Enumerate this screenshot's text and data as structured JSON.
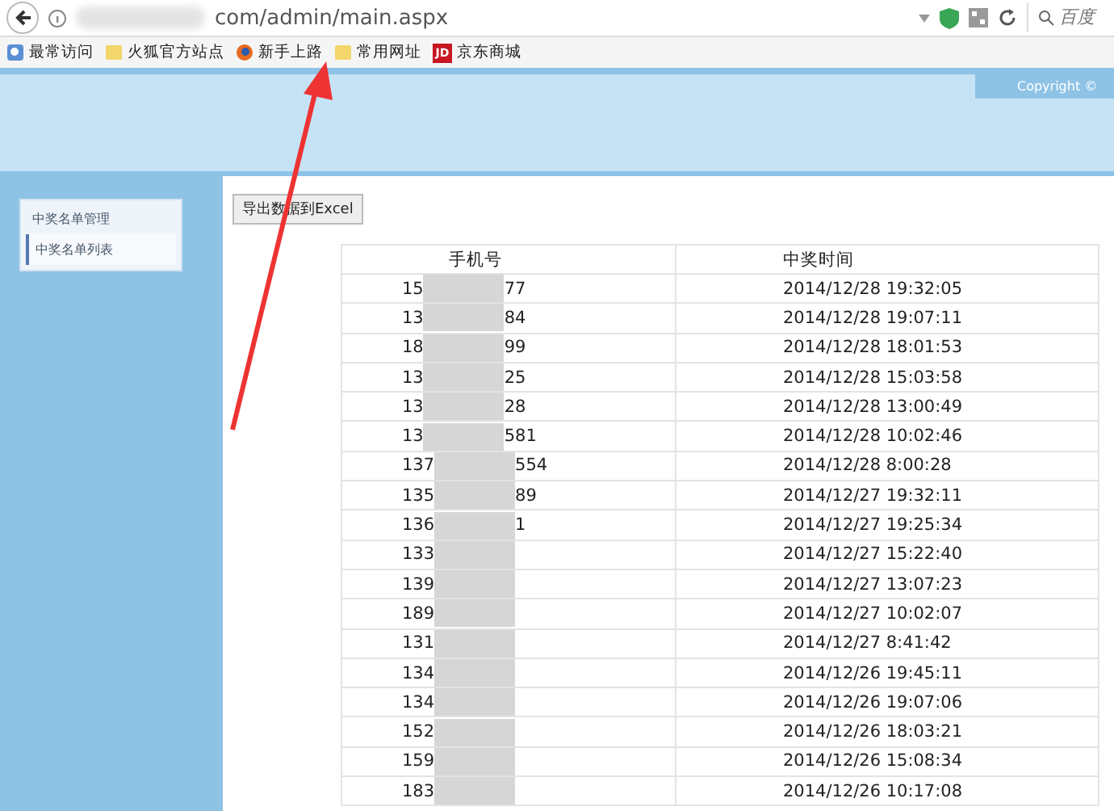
{
  "browser": {
    "url": "com/admin/main.aspx",
    "search_placeholder": "百度",
    "bookmarks": [
      {
        "label": "最常访问",
        "kind": "recent"
      },
      {
        "label": "火狐官方站点",
        "kind": "folder"
      },
      {
        "label": "新手上路",
        "kind": "firefox"
      },
      {
        "label": "常用网址",
        "kind": "folder"
      },
      {
        "label": "京东商城",
        "kind": "jd",
        "icon_text": "JD"
      }
    ]
  },
  "header": {
    "copyright": "Copyright ©"
  },
  "sidebar": {
    "title": "中奖名单管理",
    "items": [
      {
        "label": "中奖名单列表",
        "selected": true
      }
    ]
  },
  "toolbar": {
    "export_button": "导出数据到Excel"
  },
  "table": {
    "columns": [
      "手机号",
      "中奖时间"
    ],
    "rows": [
      {
        "phone_start": "15",
        "phone_end": "77",
        "time": "2014/12/28 19:32:05"
      },
      {
        "phone_start": "13",
        "phone_end": "84",
        "time": "2014/12/28 19:07:11"
      },
      {
        "phone_start": "18",
        "phone_end": "99",
        "time": "2014/12/28 18:01:53"
      },
      {
        "phone_start": "13",
        "phone_end": "25",
        "time": "2014/12/28 15:03:58"
      },
      {
        "phone_start": "13",
        "phone_end": "28",
        "time": "2014/12/28 13:00:49"
      },
      {
        "phone_start": "13",
        "phone_end": "581",
        "time": "2014/12/28 10:02:46"
      },
      {
        "phone_start": "137",
        "phone_end": "554",
        "time": "2014/12/28 8:00:28"
      },
      {
        "phone_start": "135",
        "phone_end": "89",
        "time": "2014/12/27 19:32:11"
      },
      {
        "phone_start": "136",
        "phone_end": "1",
        "time": "2014/12/27 19:25:34"
      },
      {
        "phone_start": "133",
        "time": "2014/12/27 15:22:40"
      },
      {
        "phone_start": "139",
        "time": "2014/12/27 13:07:23"
      },
      {
        "phone_start": "189",
        "time": "2014/12/27 10:02:07"
      },
      {
        "phone_start": "131",
        "time": "2014/12/27 8:41:42"
      },
      {
        "phone_start": "134",
        "time": "2014/12/26 19:45:11"
      },
      {
        "phone_start": "134",
        "time": "2014/12/26 19:07:06"
      },
      {
        "phone_start": "152",
        "time": "2014/12/26 18:03:21"
      },
      {
        "phone_start": "159",
        "time": "2014/12/26 15:08:34"
      },
      {
        "phone_start": "183",
        "time": "2014/12/26 10:17:08"
      }
    ]
  }
}
